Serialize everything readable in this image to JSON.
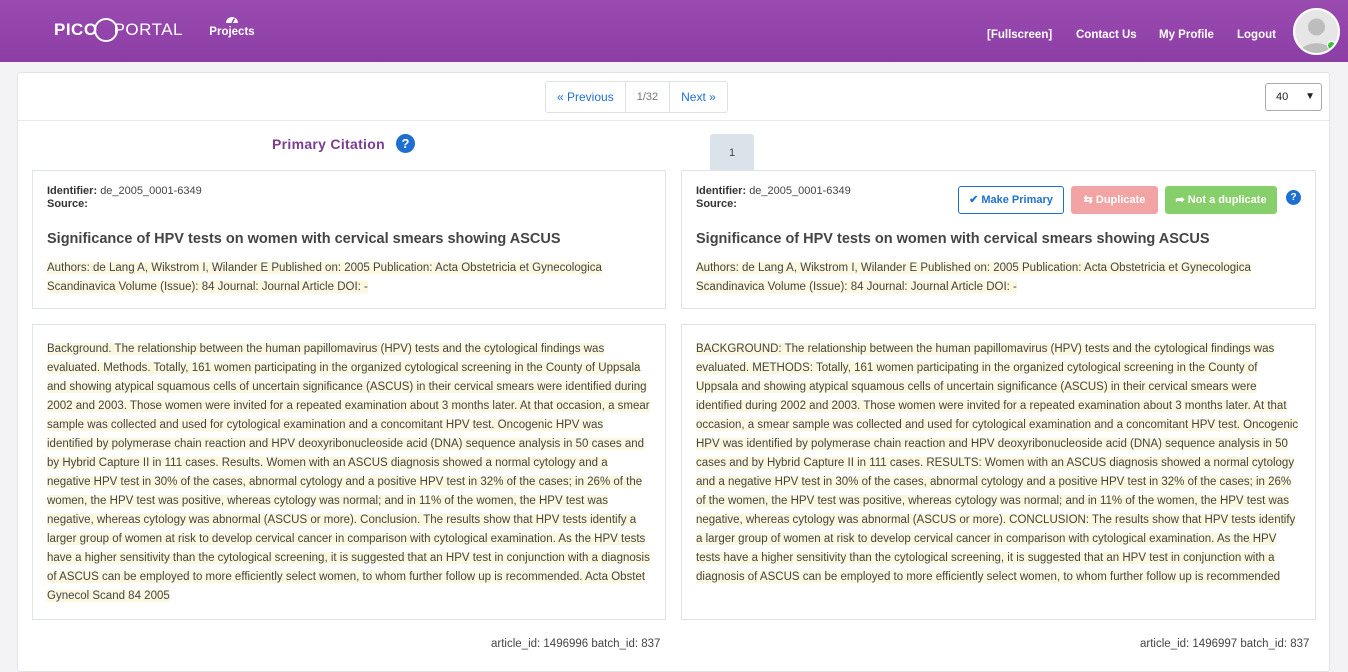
{
  "header": {
    "logo_left": "PICO",
    "logo_right": "PORTAL",
    "projects_label": "Projects",
    "fullscreen_label": "[Fullscreen]",
    "contact_label": "Contact Us",
    "profile_label": "My Profile",
    "logout_label": "Logout",
    "colors": {
      "brand": "#8b3ea5",
      "online": "#3cbf3c"
    }
  },
  "pager": {
    "previous_label": "« Previous",
    "count": "1/32",
    "next_label": "Next »",
    "per_page": "40"
  },
  "primary_heading": "Primary Citation",
  "help_icon_label": "?",
  "compare_tab": "1",
  "left": {
    "identifier_label": "Identifier:",
    "identifier": "de_2005_0001-6349",
    "source_label": "Source:",
    "title": "Significance of HPV tests on women with cervical smears showing ASCUS",
    "meta": "Authors: de Lang A, Wikstrom I, Wilander E Published on: 2005 Publication: Acta Obstetricia et Gynecologica Scandinavica Volume (Issue): 84 Journal: Journal Article DOI: -",
    "abstract": "Background. The relationship between the human papillomavirus (HPV) tests and the cytological findings was evaluated. Methods. Totally, 161 women participating in the organized cytological screening in the County of Uppsala and showing atypical squamous cells of uncertain significance (ASCUS) in their cervical smears were identified during 2002 and 2003. Those women were invited for a repeated examination about 3 months later. At that occasion, a smear sample was collected and used for cytological examination and a concomitant HPV test. Oncogenic HPV was identified by polymerase chain reaction and HPV deoxyribonucleoside acid (DNA) sequence analysis in 50 cases and by Hybrid Capture II in 111 cases. Results. Women with an ASCUS diagnosis showed a normal cytology and a negative HPV test in 30% of the cases, abnormal cytology and a positive HPV test in 32% of the cases; in 26% of the women, the HPV test was positive, whereas cytology was normal; and in 11% of the women, the HPV test was negative, whereas cytology was abnormal (ASCUS or more). Conclusion. The results show that HPV tests identify a larger group of women at risk to develop cervical cancer in comparison with cytological examination. As the HPV tests have a higher sensitivity than the cytological screening, it is suggested that an HPV test in conjunction with a diagnosis of ASCUS can be employed to more efficiently select women, to whom further follow up is recommended. Acta Obstet Gynecol Scand 84 2005",
    "footer": "article_id: 1496996  batch_id: 837"
  },
  "right": {
    "identifier_label": "Identifier:",
    "identifier": "de_2005_0001-6349",
    "source_label": "Source:",
    "make_primary_label": "Make Primary",
    "duplicate_label": "Duplicate",
    "not_duplicate_label": "Not a duplicate",
    "title": "Significance of HPV tests on women with cervical smears showing ASCUS",
    "meta": "Authors: de Lang A, Wikstrom I, Wilander E Published on: 2005 Publication: Acta Obstetricia et Gynecologica Scandinavica Volume (Issue): 84 Journal: Journal Article DOI: -",
    "abstract": "BACKGROUND: The relationship between the human papillomavirus (HPV) tests and the cytological findings was evaluated. METHODS: Totally, 161 women participating in the organized cytological screening in the County of Uppsala and showing atypical squamous cells of uncertain significance (ASCUS) in their cervical smears were identified during 2002 and 2003. Those women were invited for a repeated examination about 3 months later. At that occasion, a smear sample was collected and used for cytological examination and a concomitant HPV test. Oncogenic HPV was identified by polymerase chain reaction and HPV deoxyribonucleoside acid (DNA) sequence analysis in 50 cases and by Hybrid Capture II in 111 cases. RESULTS: Women with an ASCUS diagnosis showed a normal cytology and a negative HPV test in 30% of the cases, abnormal cytology and a positive HPV test in 32% of the cases; in 26% of the women, the HPV test was positive, whereas cytology was normal; and in 11% of the women, the HPV test was negative, whereas cytology was abnormal (ASCUS or more). CONCLUSION: The results show that HPV tests identify a larger group of women at risk to develop cervical cancer in comparison with cytological examination. As the HPV tests have a higher sensitivity than the cytological screening, it is suggested that an HPV test in conjunction with a diagnosis of ASCUS can be employed to more efficiently select women, to whom further follow up is recommended",
    "footer": "article_id: 1496997  batch_id: 837"
  }
}
